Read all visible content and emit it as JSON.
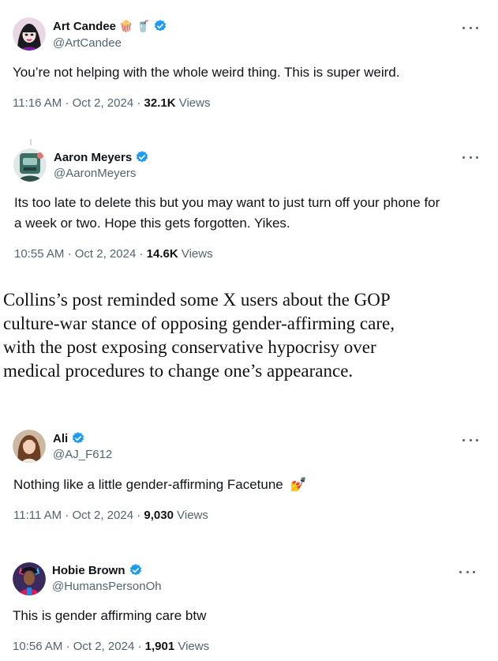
{
  "tweets": [
    {
      "display_name": "Art Candee",
      "handle": "@ArtCandee",
      "name_emojis": [
        "🍿",
        "🥤"
      ],
      "verified": true,
      "text": "You’re not helping with the whole weird thing. This is super weird.",
      "time": "11:16 AM",
      "date": "Oct 2, 2024",
      "views_count": "32.1K",
      "views_label": "Views"
    },
    {
      "display_name": "Aaron Meyers",
      "handle": "@AaronMeyers",
      "verified": true,
      "text_line1": "Its too late to delete this but you may want to just turn off your phone for",
      "text_line2": "a week or two. Hope this gets forgotten. Yikes.",
      "time": "10:55 AM",
      "date": "Oct 2, 2024",
      "views_count": "14.6K",
      "views_label": "Views"
    },
    {
      "display_name": "Ali",
      "handle": "@AJ_F612",
      "verified": true,
      "text": "Nothing like a little gender-affirming Facetune",
      "text_emoji": "💅",
      "time": "11:11 AM",
      "date": "Oct 2, 2024",
      "views_count": "9,030",
      "views_label": "Views"
    },
    {
      "display_name": "Hobie Brown",
      "handle": "@HumansPersonOh",
      "verified": true,
      "text": "This is gender affirming care btw",
      "time": "10:56 AM",
      "date": "Oct 2, 2024",
      "views_count": "1,901",
      "views_label": "Views"
    }
  ],
  "caption": {
    "line1": "Collins’s post reminded some X users about the GOP",
    "line2": "culture-war stance of opposing gender-affirming care,",
    "line3": "with the post exposing conservative hypocrisy over",
    "line4": "medical procedures to change one’s appearance."
  },
  "separator": "·",
  "colors": {
    "verified_blue": "#1d9bf0",
    "secondary_text": "#536471",
    "primary_text": "#0f1419"
  }
}
